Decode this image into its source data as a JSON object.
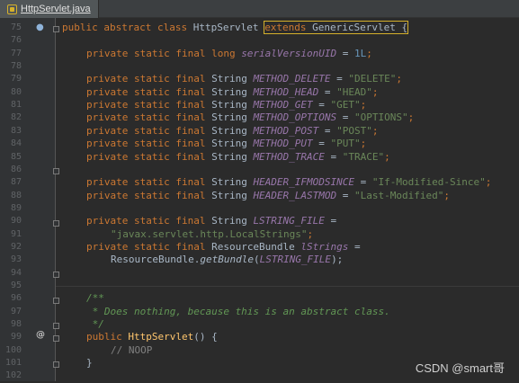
{
  "tab": {
    "label": "HttpServlet.java",
    "icon": "java-class-icon"
  },
  "gutter_marks": {
    "line75": "override-down-icon",
    "line99": "annotation-at-icon"
  },
  "lines": [
    {
      "n": "75"
    },
    {
      "n": "76"
    },
    {
      "n": "77"
    },
    {
      "n": "78"
    },
    {
      "n": "79"
    },
    {
      "n": "80"
    },
    {
      "n": "81"
    },
    {
      "n": "82"
    },
    {
      "n": "83"
    },
    {
      "n": "84"
    },
    {
      "n": "85"
    },
    {
      "n": "86"
    },
    {
      "n": "87"
    },
    {
      "n": "88"
    },
    {
      "n": "89"
    },
    {
      "n": "90"
    },
    {
      "n": "91"
    },
    {
      "n": "92"
    },
    {
      "n": "93"
    },
    {
      "n": "94"
    },
    {
      "n": "95"
    },
    {
      "n": "96"
    },
    {
      "n": "97"
    },
    {
      "n": "98"
    },
    {
      "n": "99"
    },
    {
      "n": "100"
    },
    {
      "n": "101"
    },
    {
      "n": "102"
    }
  ],
  "code": {
    "l75": {
      "t1": "public abstract class ",
      "t2": "HttpServlet ",
      "t3": "extends ",
      "t4": "GenericServlet {"
    },
    "l77": {
      "kw": "private static final long ",
      "name": "serialVersionUID",
      " eq": " = ",
      "val": "1L",
      ";": ";"
    },
    "l79": {
      "kw": "private static final ",
      "type": "String ",
      "name": "METHOD_DELETE",
      "eq": " = ",
      "val": "\"DELETE\"",
      "end": ";"
    },
    "l80": {
      "kw": "private static final ",
      "type": "String ",
      "name": "METHOD_HEAD",
      "eq": " = ",
      "val": "\"HEAD\"",
      "end": ";"
    },
    "l81": {
      "kw": "private static final ",
      "type": "String ",
      "name": "METHOD_GET",
      "eq": " = ",
      "val": "\"GET\"",
      "end": ";"
    },
    "l82": {
      "kw": "private static final ",
      "type": "String ",
      "name": "METHOD_OPTIONS",
      "eq": " = ",
      "val": "\"OPTIONS\"",
      "end": ";"
    },
    "l83": {
      "kw": "private static final ",
      "type": "String ",
      "name": "METHOD_POST",
      "eq": " = ",
      "val": "\"POST\"",
      "end": ";"
    },
    "l84": {
      "kw": "private static final ",
      "type": "String ",
      "name": "METHOD_PUT",
      "eq": " = ",
      "val": "\"PUT\"",
      "end": ";"
    },
    "l85": {
      "kw": "private static final ",
      "type": "String ",
      "name": "METHOD_TRACE",
      "eq": " = ",
      "val": "\"TRACE\"",
      "end": ";"
    },
    "l87": {
      "kw": "private static final ",
      "type": "String ",
      "name": "HEADER_IFMODSINCE",
      "eq": " = ",
      "val": "\"If-Modified-Since\"",
      "end": ";"
    },
    "l88": {
      "kw": "private static final ",
      "type": "String ",
      "name": "HEADER_LASTMOD",
      "eq": " = ",
      "val": "\"Last-Modified\"",
      "end": ";"
    },
    "l90": {
      "kw": "private static final ",
      "type": "String ",
      "name": "LSTRING_FILE",
      "eq": " ="
    },
    "l91": {
      "val": "\"javax.servlet.http.LocalStrings\"",
      "end": ";"
    },
    "l92": {
      "kw": "private static final ",
      "type": "ResourceBundle ",
      "name": "lStrings",
      "eq": " ="
    },
    "l93": {
      "a": "ResourceBundle.",
      "fn": "getBundle",
      "b": "(",
      "name": "LSTRING_FILE",
      "c": ");"
    },
    "l96": {
      "t": "/**"
    },
    "l97": {
      "t": " * Does nothing, because this is an abstract class."
    },
    "l98": {
      "t": " */"
    },
    "l99": {
      "kw": "public ",
      "fn": "HttpServlet",
      "rest": "() {"
    },
    "l100": {
      "t": "// NOOP"
    },
    "l101": {
      "t": "}"
    }
  },
  "watermark": "CSDN @smart哥",
  "colors": {
    "keyword": "#cc7832",
    "constant": "#9876aa",
    "string": "#6a8759",
    "number": "#6897bb",
    "comment": "#629755",
    "method": "#ffc66d",
    "highlight": "#d6b12b"
  }
}
